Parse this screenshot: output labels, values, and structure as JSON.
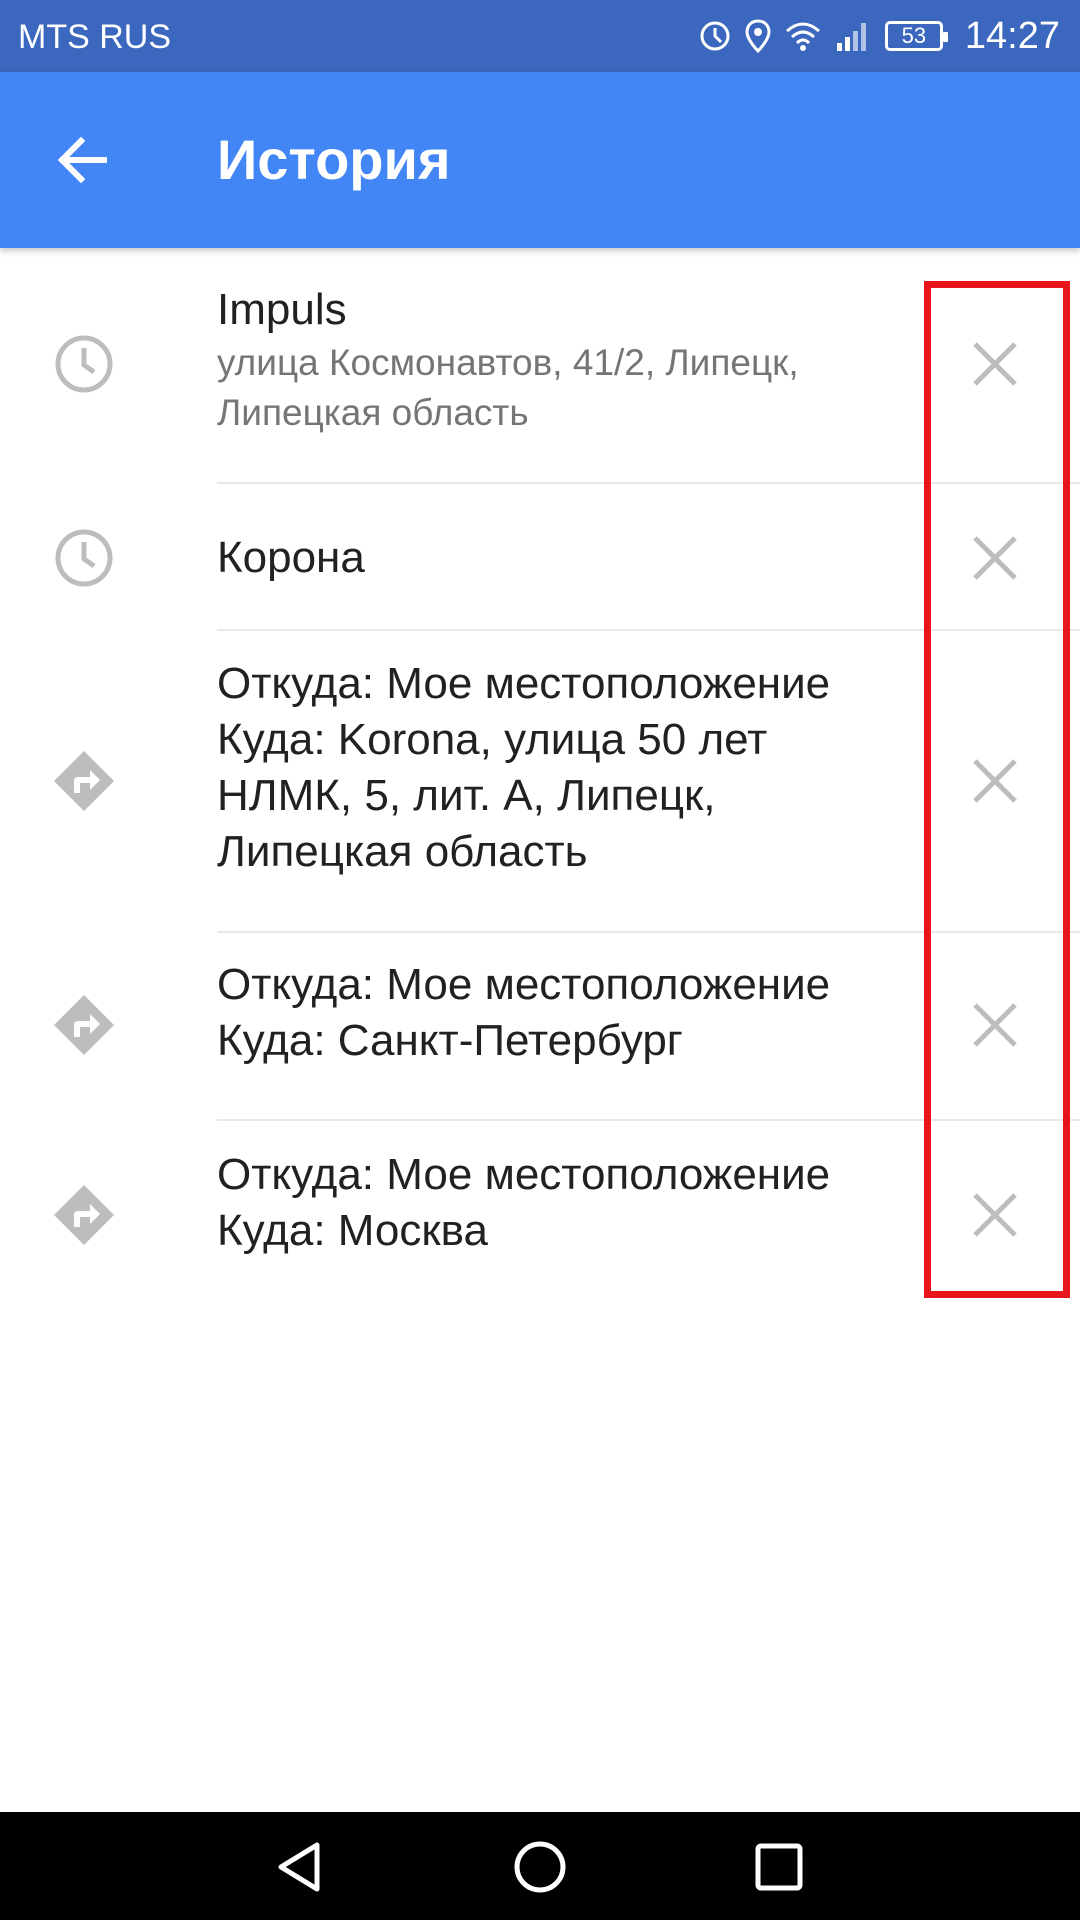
{
  "status_bar": {
    "carrier": "MTS RUS",
    "battery_level": "53",
    "time": "14:27",
    "icons": [
      "data-saver-icon",
      "location-icon",
      "wifi-icon",
      "signal-icon",
      "battery-icon"
    ]
  },
  "app_bar": {
    "title": "История",
    "back_icon": "arrow-back-icon"
  },
  "history": [
    {
      "type": "place",
      "icon": "clock-icon",
      "primary": "Impuls",
      "secondary": "улица Космонавтов, 41/2, Липецк,\nЛипецкая область"
    },
    {
      "type": "place",
      "icon": "clock-icon",
      "primary": "Корона"
    },
    {
      "type": "route",
      "icon": "directions-icon",
      "primary": "Откуда: Мое местоположение\nКуда: Korona, улица 50 лет\nНЛМК, 5, лит. А, Липецк,\nЛипецкая область"
    },
    {
      "type": "route",
      "icon": "directions-icon",
      "primary": "Откуда: Мое местоположение\nКуда: Санкт-Петербург"
    },
    {
      "type": "route",
      "icon": "directions-icon",
      "primary": "Откуда: Мое местоположение\nКуда: Москва"
    }
  ],
  "remove_icon": "close-icon",
  "highlight_color": "#e8151b",
  "colors": {
    "status_bar": "#3b67be",
    "app_bar": "#4285f4",
    "icon_gray": "#bdbdbd"
  },
  "nav_bar": {
    "icons": [
      "back-triangle-icon",
      "home-circle-icon",
      "recents-square-icon"
    ]
  }
}
